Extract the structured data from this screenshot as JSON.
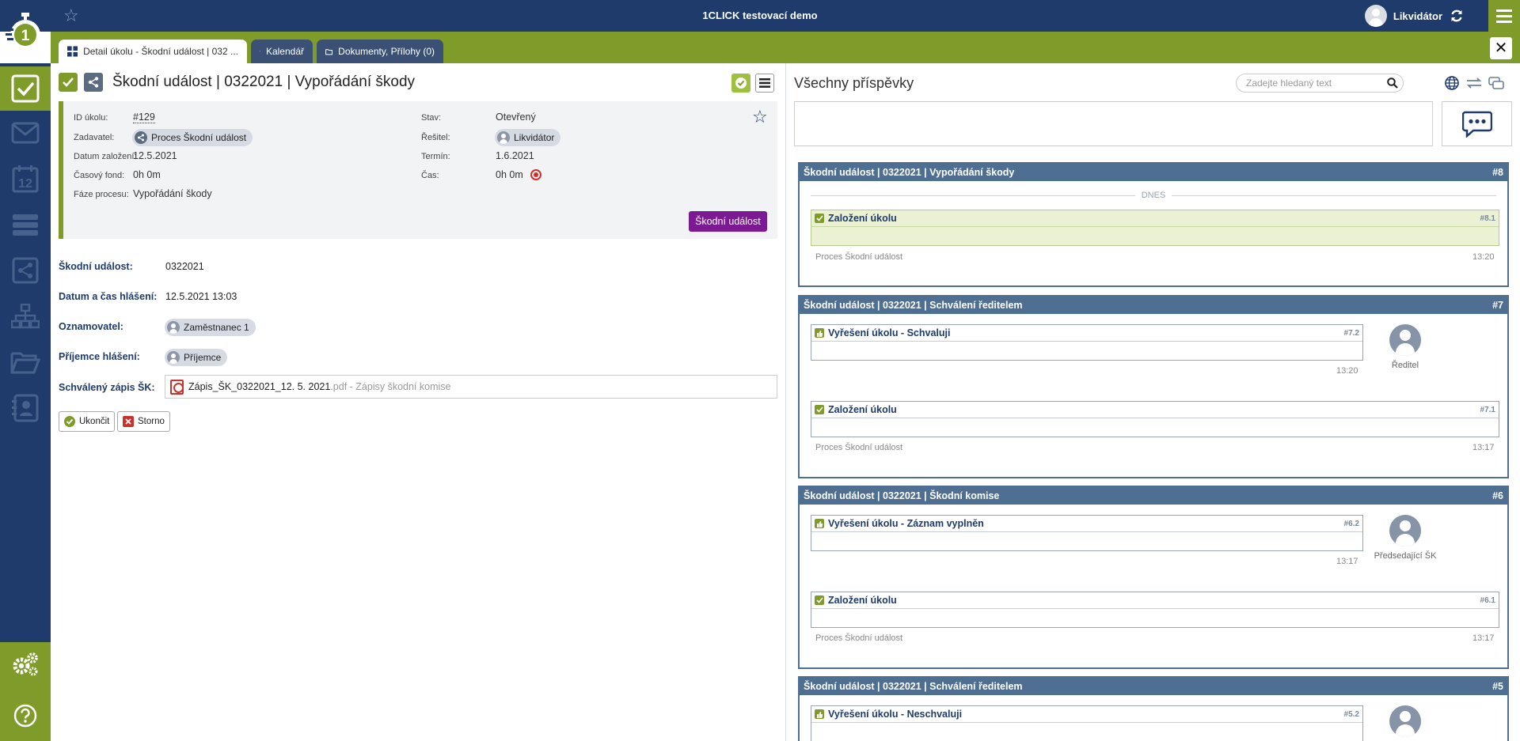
{
  "app": {
    "title": "1CLICK testovací demo",
    "user": "Likvidátor"
  },
  "tabs": [
    {
      "label": "Detail úkolu - Škodní událost | 032 ..."
    },
    {
      "label": "Kalendář"
    },
    {
      "label": "Dokumenty, Přílohy (0)"
    }
  ],
  "task": {
    "title": "Škodní událost | 0322021 | Vypořádání škody",
    "fields": {
      "id_label": "ID úkolu:",
      "id_value": "#129",
      "zadavatel_label": "Zadavatel:",
      "zadavatel_value": "Proces Škodní událost",
      "datum_label": "Datum založení:",
      "datum_value": "12.5.2021",
      "fond_label": "Časový fond:",
      "fond_value": "0h 0m",
      "faze_label": "Fáze procesu:",
      "faze_value": "Vypořádání škody",
      "stav_label": "Stav:",
      "stav_value": "Otevřený",
      "resitel_label": "Řešitel:",
      "resitel_value": "Likvidátor",
      "termin_label": "Termín:",
      "termin_value": "1.6.2021",
      "cas_label": "Čas:",
      "cas_value": "0h 0m"
    },
    "process_button": "Škodní událost"
  },
  "form": {
    "skodni_label": "Škodní událost:",
    "skodni_value": "0322021",
    "datum_label": "Datum a čas hlášení:",
    "datum_value": "12.5.2021 13:03",
    "oznam_label": "Oznamovatel:",
    "oznam_value": "Zaměstnanec 1",
    "prijemce_label": "Příjemce hlášení:",
    "prijemce_value": "Příjemce",
    "zapis_label": "Schválený zápis ŠK:",
    "zapis_file": "Zápis_ŠK_0322021_12. 5. 2021",
    "zapis_ext": ".pdf - Zápisy škodní komise",
    "ukoncit": "Ukončit",
    "storno": "Storno"
  },
  "right": {
    "title": "Všechny příspěvky",
    "search_placeholder": "Zadejte hledaný text",
    "today": "DNES",
    "threads": [
      {
        "title": "Škodní událost | 0322021 | Vypořádání škody",
        "num": "#8",
        "posts": [
          {
            "title": "Založení úkolu",
            "num": "#8.1",
            "by": "Proces Škodní událost",
            "time": "13:20"
          }
        ]
      },
      {
        "title": "Škodní událost | 0322021 | Schválení ředitelem",
        "num": "#7",
        "posts": [
          {
            "title": "Vyřešení úkolu - Schvaluji",
            "num": "#7.2",
            "time": "13:20",
            "avatar_name": "Ředitel"
          },
          {
            "title": "Založení úkolu",
            "num": "#7.1",
            "by": "Proces Škodní událost",
            "time": "13:17"
          }
        ]
      },
      {
        "title": "Škodní událost | 0322021 | Škodní komise",
        "num": "#6",
        "posts": [
          {
            "title": "Vyřešení úkolu - Záznam vyplněn",
            "num": "#6.2",
            "time": "13:17",
            "avatar_name": "Předsedající ŠK"
          },
          {
            "title": "Založení úkolu",
            "num": "#6.1",
            "by": "Proces Škodní událost",
            "time": "13:17"
          }
        ]
      },
      {
        "title": "Škodní událost | 0322021 | Schválení ředitelem",
        "num": "#5",
        "posts": [
          {
            "title": "Vyřešení úkolu - Neschvaluji",
            "num": "#5.2"
          }
        ]
      }
    ]
  },
  "colors": {
    "navy": "#1f3b6b",
    "green": "#7f9c2a",
    "purple": "#7b1a93",
    "thread_header": "#4e6f91"
  }
}
